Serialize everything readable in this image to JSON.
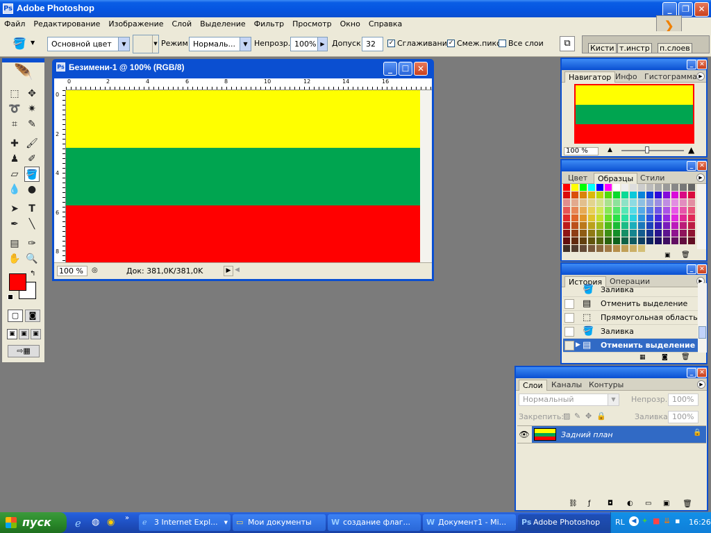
{
  "app": {
    "title": "Adobe Photoshop"
  },
  "menu": [
    "Файл",
    "Редактирование",
    "Изображение",
    "Слой",
    "Выделение",
    "Фильтр",
    "Просмотр",
    "Окно",
    "Справка"
  ],
  "options": {
    "fill_source": "Основной цвет",
    "mode_label": "Режим:",
    "mode_value": "Нормаль...",
    "opacity_label": "Непрозр.:",
    "opacity_value": "100%",
    "tolerance_label": "Допуск:",
    "tolerance_value": "32",
    "antialias_label": "Сглаживание",
    "contiguous_label": "Смеж.пикс",
    "all_layers_label": "Все слои",
    "palette_well_tabs": [
      "Кисти",
      "т.инстр",
      "п.слоев"
    ]
  },
  "document": {
    "title": "Безимени-1 @ 100% (RGB/8)",
    "zoom": "100 %",
    "doc_info": "Док: 381,0K/381,0K",
    "ruler_h": [
      "0",
      "2",
      "4",
      "6",
      "8",
      "10",
      "12",
      "14",
      "16"
    ],
    "ruler_v": [
      "0",
      "2",
      "4",
      "6",
      "8"
    ],
    "stripes": [
      "#ffff00",
      "#00a550",
      "#ff0000"
    ]
  },
  "colors": {
    "foreground": "#ff0000",
    "background": "#ffffff",
    "accent": "#0a4fd1"
  },
  "navigator": {
    "tabs": [
      "Навигатор",
      "Инфо",
      "Гистограмма"
    ],
    "zoom": "100 %"
  },
  "swatches": {
    "tabs": [
      "Цвет",
      "Образцы",
      "Стили"
    ]
  },
  "history": {
    "tabs": [
      "История",
      "Операции"
    ],
    "items": [
      {
        "icon": "paint-bucket-icon",
        "label": "Заливка"
      },
      {
        "icon": "deselect-icon",
        "label": "Отменить выделение"
      },
      {
        "icon": "rect-marquee-icon",
        "label": "Прямоугольная область"
      },
      {
        "icon": "paint-bucket-icon",
        "label": "Заливка"
      },
      {
        "icon": "deselect-icon",
        "label": "Отменить выделение"
      }
    ]
  },
  "layers": {
    "tabs": [
      "Слои",
      "Каналы",
      "Контуры"
    ],
    "blend_mode": "Нормальный",
    "opacity_label": "Непрозр.:",
    "opacity_value": "100%",
    "lock_label": "Закрепить:",
    "fill_label": "Заливка:",
    "fill_value": "100%",
    "layer_name": "Задний план"
  },
  "taskbar": {
    "start": "пуск",
    "buttons": [
      "3 Internet Expl...",
      "Мои документы",
      "создание флаг...",
      "Документ1 - Mi...",
      "Adobe Photoshop"
    ],
    "lang": "RL",
    "clock": "16:26"
  }
}
